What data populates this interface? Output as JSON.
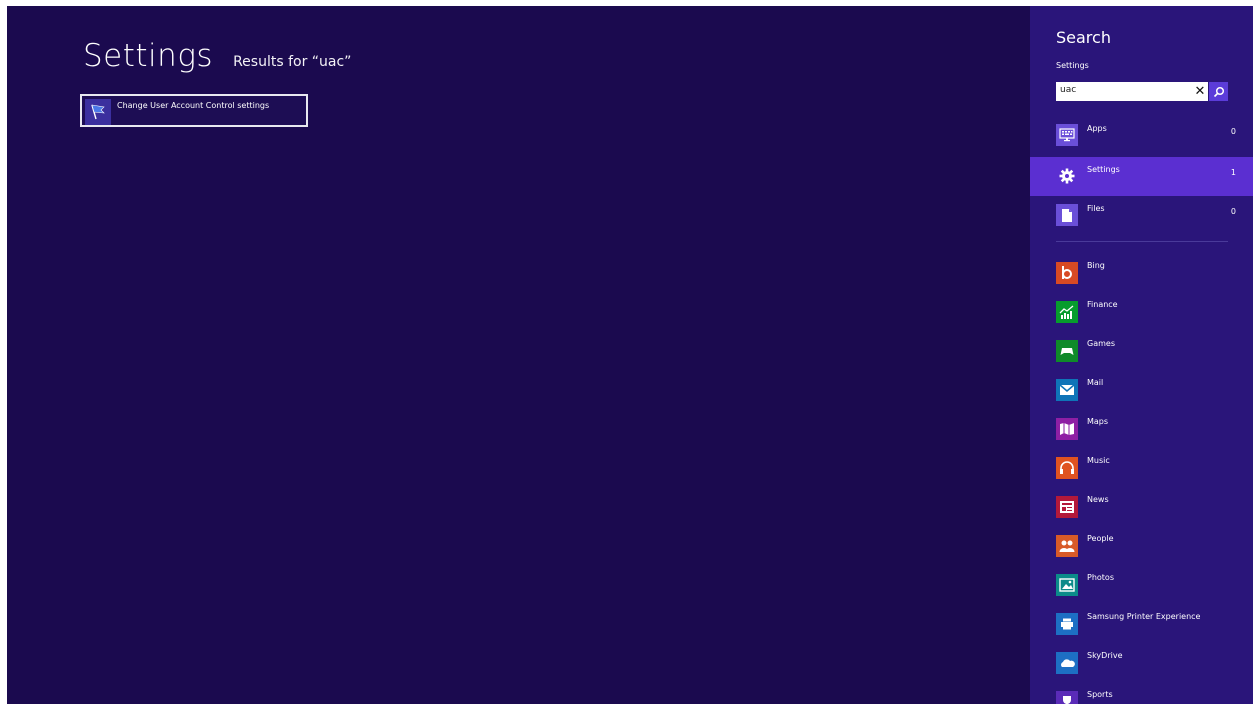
{
  "main": {
    "title": "Settings",
    "subtitle": "Results for “uac”",
    "results": [
      {
        "label": "Change User Account Control settings",
        "icon": "uac-flag-icon"
      }
    ]
  },
  "search": {
    "title": "Search",
    "scope": "Settings",
    "query": "uac",
    "clear_icon": "close-icon",
    "go_icon": "search-icon",
    "scopes": [
      {
        "label": "Apps",
        "count": "0",
        "icon": "apps-keyboard-icon",
        "active": false
      },
      {
        "label": "Settings",
        "count": "1",
        "icon": "gear-icon",
        "active": true
      },
      {
        "label": "Files",
        "count": "0",
        "icon": "file-icon",
        "active": false
      }
    ],
    "apps": [
      {
        "label": "Bing",
        "icon": "bing-icon",
        "color": "#d84a24"
      },
      {
        "label": "Finance",
        "icon": "finance-chart-icon",
        "color": "#079c2d"
      },
      {
        "label": "Games",
        "icon": "gamepad-icon",
        "color": "#0f8a2a"
      },
      {
        "label": "Mail",
        "icon": "envelope-icon",
        "color": "#0f74b8"
      },
      {
        "label": "Maps",
        "icon": "map-icon",
        "color": "#8e1fa4"
      },
      {
        "label": "Music",
        "icon": "headphones-icon",
        "color": "#e05321"
      },
      {
        "label": "News",
        "icon": "newspaper-icon",
        "color": "#b3193a"
      },
      {
        "label": "People",
        "icon": "people-icon",
        "color": "#d85a28"
      },
      {
        "label": "Photos",
        "icon": "photo-icon",
        "color": "#0c8b8a"
      },
      {
        "label": "Samsung Printer Experience",
        "icon": "printer-icon",
        "color": "#1d6fc4"
      },
      {
        "label": "SkyDrive",
        "icon": "cloud-icon",
        "color": "#1d6fc4"
      },
      {
        "label": "Sports",
        "icon": "trophy-icon",
        "color": "#5a2bb8"
      }
    ]
  }
}
